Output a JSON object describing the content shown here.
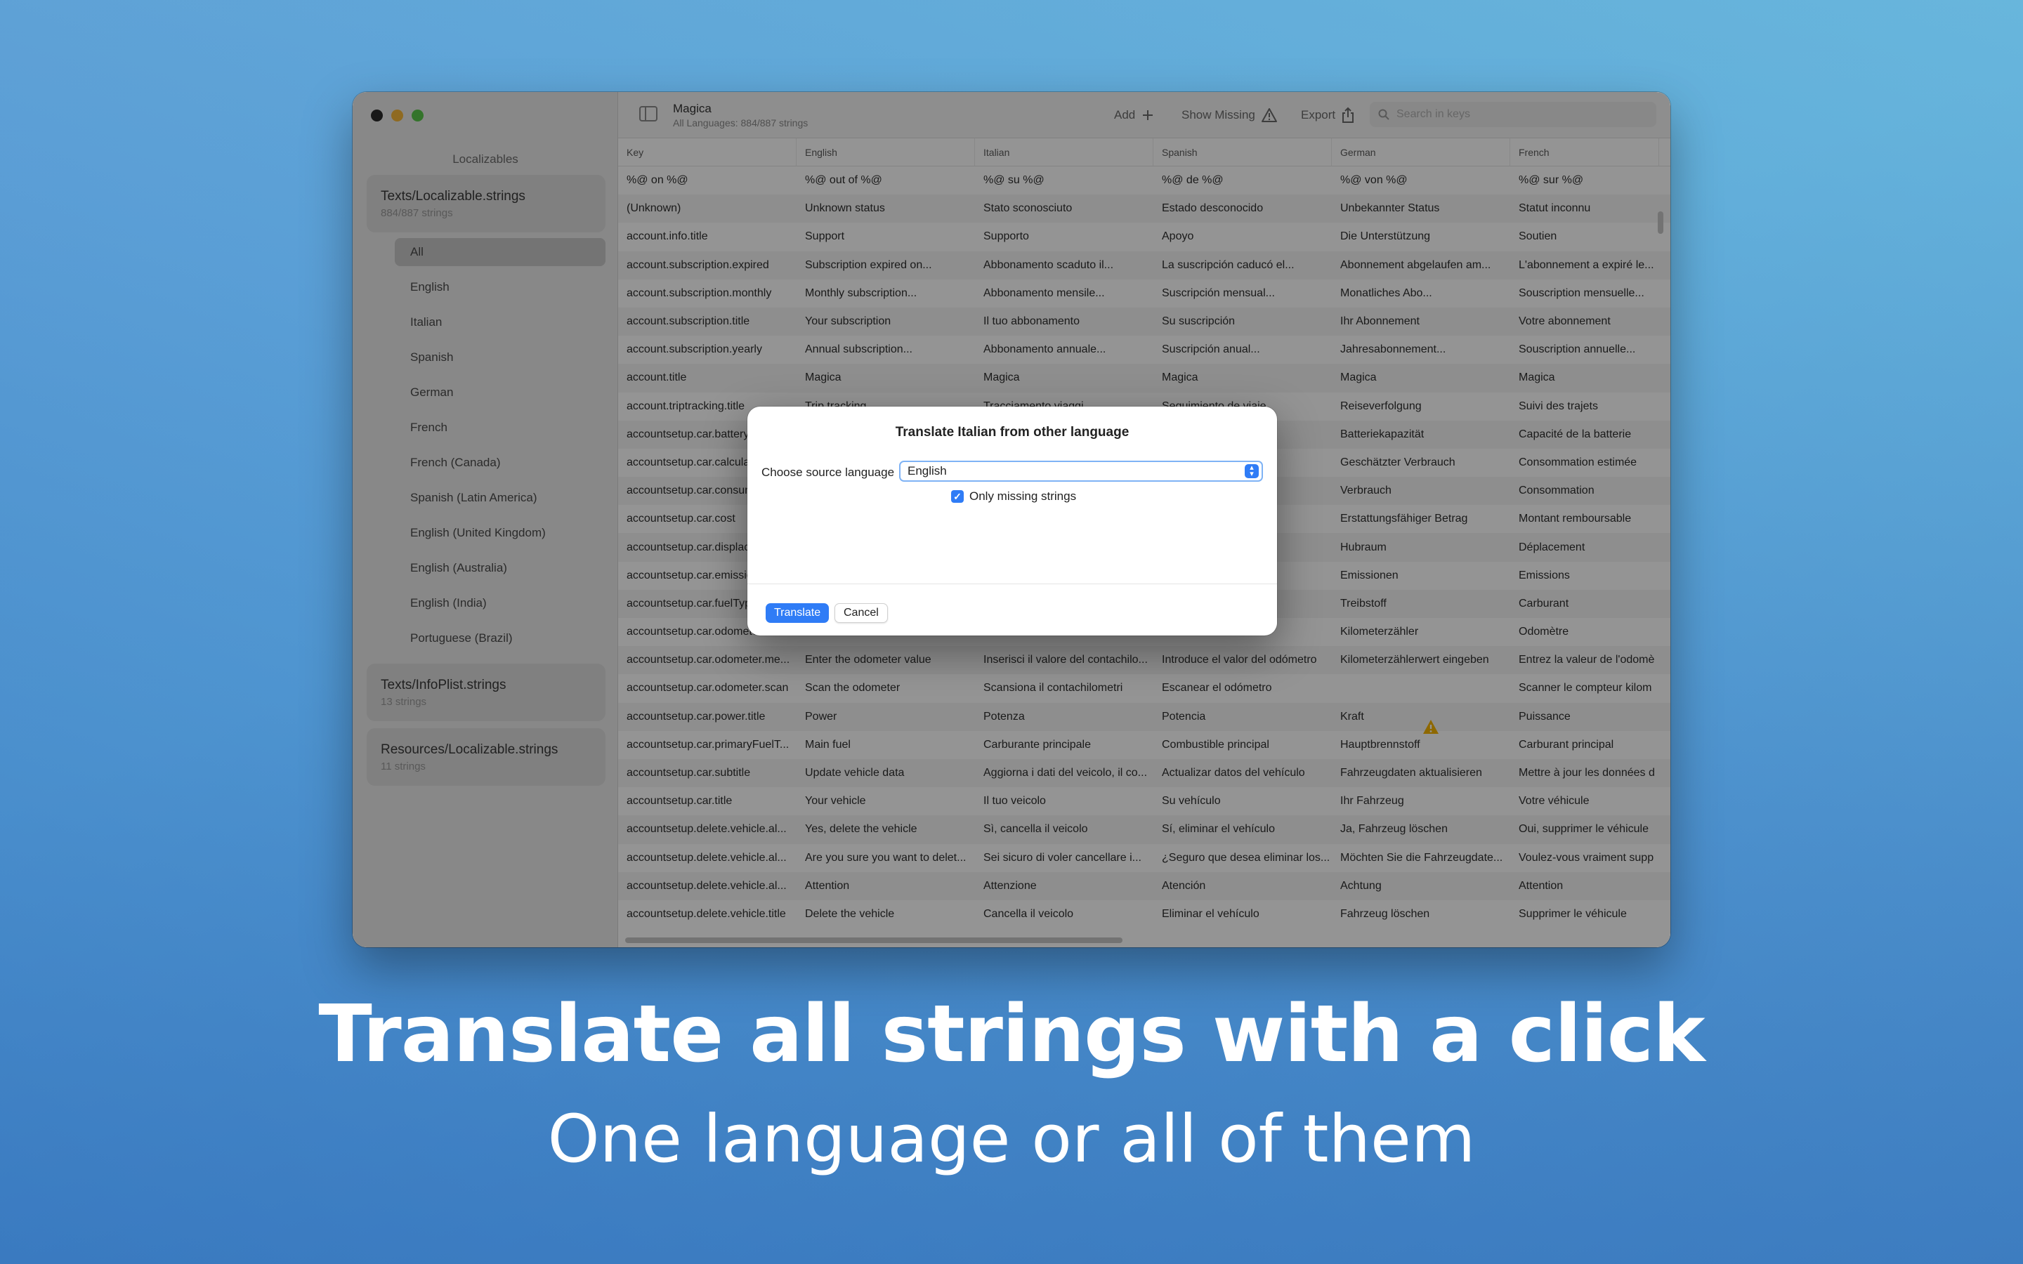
{
  "sidebar": {
    "heading": "Localizables",
    "files": [
      {
        "title": "Texts/Localizable.strings",
        "subtitle": "884/887 strings"
      },
      {
        "title": "Texts/InfoPlist.strings",
        "subtitle": "13 strings"
      },
      {
        "title": "Resources/Localizable.strings",
        "subtitle": "11 strings"
      }
    ],
    "languages": [
      "All",
      "English",
      "Italian",
      "Spanish",
      "German",
      "French",
      "French (Canada)",
      "Spanish (Latin America)",
      "English (United Kingdom)",
      "English (Australia)",
      "English (India)",
      "Portuguese (Brazil)"
    ]
  },
  "toolbar": {
    "title": "Magica",
    "subtitle": "All Languages: 884/887 strings",
    "add_label": "Add",
    "show_missing_label": "Show Missing",
    "export_label": "Export",
    "search_placeholder": "Search in keys"
  },
  "table": {
    "columns": [
      "Key",
      "English",
      "Italian",
      "Spanish",
      "German",
      "French"
    ],
    "rows": [
      [
        "%@ on %@",
        "%@ out of %@",
        "%@ su %@",
        "%@ de %@",
        "%@ von %@",
        "%@ sur %@"
      ],
      [
        "(Unknown)",
        "Unknown status",
        "Stato sconosciuto",
        "Estado desconocido",
        "Unbekannter Status",
        "Statut inconnu"
      ],
      [
        "account.info.title",
        "Support",
        "Supporto",
        "Apoyo",
        "Die Unterstützung",
        "Soutien"
      ],
      [
        "account.subscription.expired",
        "Subscription expired on...",
        "Abbonamento scaduto il...",
        "La suscripción caducó el...",
        "Abonnement abgelaufen am...",
        "L'abonnement a expiré le..."
      ],
      [
        "account.subscription.monthly",
        "Monthly subscription...",
        "Abbonamento mensile...",
        "Suscripción mensual...",
        "Monatliches Abo...",
        "Souscription mensuelle..."
      ],
      [
        "account.subscription.title",
        "Your subscription",
        "Il tuo abbonamento",
        "Su suscripción",
        "Ihr Abonnement",
        "Votre abonnement"
      ],
      [
        "account.subscription.yearly",
        "Annual subscription...",
        "Abbonamento annuale...",
        "Suscripción anual...",
        "Jahresabonnement...",
        "Souscription annuelle..."
      ],
      [
        "account.title",
        "Magica",
        "Magica",
        "Magica",
        "Magica",
        "Magica"
      ],
      [
        "account.triptracking.title",
        "Trip tracking",
        "Tracciamento viaggi",
        "Seguimiento de viaje",
        "Reiseverfolgung",
        "Suivi des trajets"
      ],
      [
        "accountsetup.car.battery",
        "",
        "",
        "",
        "Batteriekapazität",
        "Capacité de la batterie"
      ],
      [
        "accountsetup.car.calculated",
        "",
        "",
        "",
        "Geschätzter Verbrauch",
        "Consommation estimée"
      ],
      [
        "accountsetup.car.consumption",
        "",
        "",
        "",
        "Verbrauch",
        "Consommation"
      ],
      [
        "accountsetup.car.cost",
        "",
        "",
        "",
        "Erstattungsfähiger Betrag",
        "Montant remboursable"
      ],
      [
        "accountsetup.car.displacement",
        "",
        "",
        "",
        "Hubraum",
        "Déplacement"
      ],
      [
        "accountsetup.car.emissions",
        "",
        "",
        "",
        "Emissionen",
        "Emissions"
      ],
      [
        "accountsetup.car.fuelType",
        "",
        "",
        "",
        "Treibstoff",
        "Carburant"
      ],
      [
        "accountsetup.car.odometer",
        "",
        "",
        "",
        "Kilometerzähler",
        "Odomètre"
      ],
      [
        "accountsetup.car.odometer.me...",
        "Enter the odometer value",
        "Inserisci il valore del contachilo...",
        "Introduce el valor del odómetro",
        "Kilometerzählerwert eingeben",
        "Entrez la valeur de l'odomè"
      ],
      [
        "accountsetup.car.odometer.scan",
        "Scan the odometer",
        "Scansiona il contachilometri",
        "Escanear el odómetro",
        "",
        "Scanner le compteur kilom"
      ],
      [
        "accountsetup.car.power.title",
        "Power",
        "Potenza",
        "Potencia",
        "Kraft",
        "Puissance"
      ],
      [
        "accountsetup.car.primaryFuelT...",
        "Main fuel",
        "Carburante principale",
        "Combustible principal",
        "Hauptbrennstoff",
        "Carburant principal"
      ],
      [
        "accountsetup.car.subtitle",
        "Update vehicle data",
        "Aggiorna i dati del veicolo, il co...",
        "Actualizar datos del vehículo",
        "Fahrzeugdaten aktualisieren",
        "Mettre à jour les données d"
      ],
      [
        "accountsetup.car.title",
        "Your vehicle",
        "Il tuo veicolo",
        "Su vehículo",
        "Ihr Fahrzeug",
        "Votre véhicule"
      ],
      [
        "accountsetup.delete.vehicle.al...",
        "Yes, delete the vehicle",
        "Sì, cancella il veicolo",
        "Sí, eliminar el vehículo",
        "Ja, Fahrzeug löschen",
        "Oui, supprimer le véhicule"
      ],
      [
        "accountsetup.delete.vehicle.al...",
        "Are you sure you want to delet...",
        "Sei sicuro di voler cancellare i...",
        "¿Seguro que desea eliminar los...",
        "Möchten Sie die Fahrzeugdate...",
        "Voulez-vous vraiment supp"
      ],
      [
        "accountsetup.delete.vehicle.al...",
        "Attention",
        "Attenzione",
        "Atención",
        "Achtung",
        "Attention"
      ],
      [
        "accountsetup.delete.vehicle.title",
        "Delete the vehicle",
        "Cancella il veicolo",
        "Eliminar el vehículo",
        "Fahrzeug löschen",
        "Supprimer le véhicule"
      ]
    ]
  },
  "dialog": {
    "title": "Translate Italian from other language",
    "source_label": "Choose source language",
    "source_value": "English",
    "checkbox_label": "Only missing strings",
    "checkbox_checked": true,
    "translate_label": "Translate",
    "cancel_label": "Cancel"
  },
  "marketing": {
    "headline": "Translate all strings with a click",
    "subline": "One language or all of them"
  },
  "colors": {
    "accent": "#2f7cf6",
    "warning": "#f4b400"
  },
  "icons": [
    "sidebar-toggle-icon",
    "plus-icon",
    "warning-icon",
    "share-icon",
    "search-icon",
    "chevron-updown-icon",
    "checkmark-icon"
  ]
}
